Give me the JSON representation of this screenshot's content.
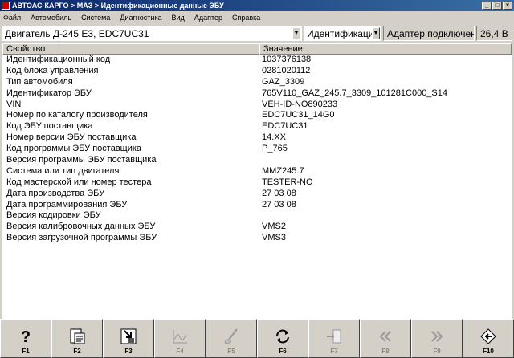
{
  "window": {
    "title": "АВТОАС-КАРГО > МАЗ > Идентификационные данные ЭБУ",
    "minimize": "_",
    "maximize": "□",
    "close": "×"
  },
  "menu": [
    "Файл",
    "Автомобиль",
    "Система",
    "Диагностика",
    "Вид",
    "Адаптер",
    "Справка"
  ],
  "toolbar": {
    "engine_select": "Двигатель Д-245 Е3, EDC7UC31",
    "mode_select": "Идентификация",
    "adapter_status": "Адаптер подключен",
    "voltage": "26,4 В",
    "arrow": "▼"
  },
  "table": {
    "headers": [
      "Свойство",
      "Значение"
    ],
    "rows": [
      [
        "Идентификационный код",
        "1037376138"
      ],
      [
        "Код блока управления",
        "0281020112"
      ],
      [
        "Тип автомобиля",
        "GAZ_3309"
      ],
      [
        "Идентификатор ЭБУ",
        "765V110_GAZ_245.7_3309_101281C000_S14"
      ],
      [
        "VIN",
        "VEH-ID-NO890233"
      ],
      [
        "Номер по каталогу производителя",
        "EDC7UC31_14G0"
      ],
      [
        "Код ЭБУ поставщика",
        "EDC7UC31"
      ],
      [
        "Номер версии ЭБУ поставщика",
        "14.XX"
      ],
      [
        "Код программы ЭБУ поставщика",
        "P_765"
      ],
      [
        "Версия программы ЭБУ поставщика",
        ""
      ],
      [
        "Система или тип двигателя",
        "MMZ245.7"
      ],
      [
        "Код мастерской или номер тестера",
        "TESTER-NO"
      ],
      [
        "Дата производства ЭБУ",
        "27 03 08"
      ],
      [
        "Дата программирования ЭБУ",
        "27 03 08"
      ],
      [
        "Версия кодировки ЭБУ",
        ""
      ],
      [
        "Версия калибровочных данных ЭБУ",
        "VMS2"
      ],
      [
        "Версия загрузочной программы ЭБУ",
        "VMS3"
      ]
    ]
  },
  "fkeys": [
    {
      "label": "F1",
      "icon": "help-icon",
      "enabled": true
    },
    {
      "label": "F2",
      "icon": "report-icon",
      "enabled": true
    },
    {
      "label": "F3",
      "icon": "save-icon",
      "enabled": true
    },
    {
      "label": "F4",
      "icon": "graph-icon",
      "enabled": false
    },
    {
      "label": "F5",
      "icon": "probe-icon",
      "enabled": false
    },
    {
      "label": "F6",
      "icon": "refresh-icon",
      "enabled": true
    },
    {
      "label": "F7",
      "icon": "import-icon",
      "enabled": false
    },
    {
      "label": "F8",
      "icon": "rewind-icon",
      "enabled": false
    },
    {
      "label": "F9",
      "icon": "forward-icon",
      "enabled": false
    },
    {
      "label": "F10",
      "icon": "exit-icon",
      "enabled": true
    }
  ],
  "colors": {
    "titlebar": "#0a246a",
    "face": "#d4d0c8",
    "grid_bg": "#ffffff"
  }
}
